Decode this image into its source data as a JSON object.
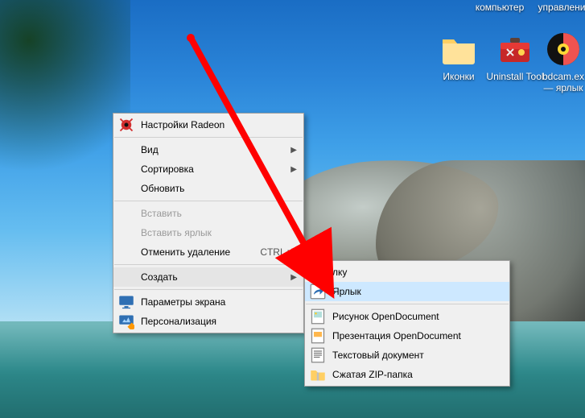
{
  "desktop_labels": {
    "computer": "компьютер",
    "management": "управлени"
  },
  "icons": {
    "folder_name": "Иконки",
    "uninstall_name": "Uninstall Tool",
    "bdcam_name": "bdcam.ex\n— ярлык"
  },
  "menu1": {
    "radeon": "Настройки Radeon",
    "view": "Вид",
    "sort": "Сортировка",
    "refresh": "Обновить",
    "paste": "Вставить",
    "paste_shortcut": "Вставить ярлык",
    "undo_delete": "Отменить удаление",
    "undo_shortcut": "CTRL+Z",
    "create": "Создать",
    "screen_params": "Параметры экрана",
    "personalization": "Персонализация"
  },
  "menu2": {
    "folder": "лку",
    "shortcut": "Ярлык",
    "picture": "Рисунок OpenDocument",
    "presentation": "Презентация OpenDocument",
    "textdoc": "Текстовый документ",
    "zip": "Сжатая ZIP-папка"
  }
}
